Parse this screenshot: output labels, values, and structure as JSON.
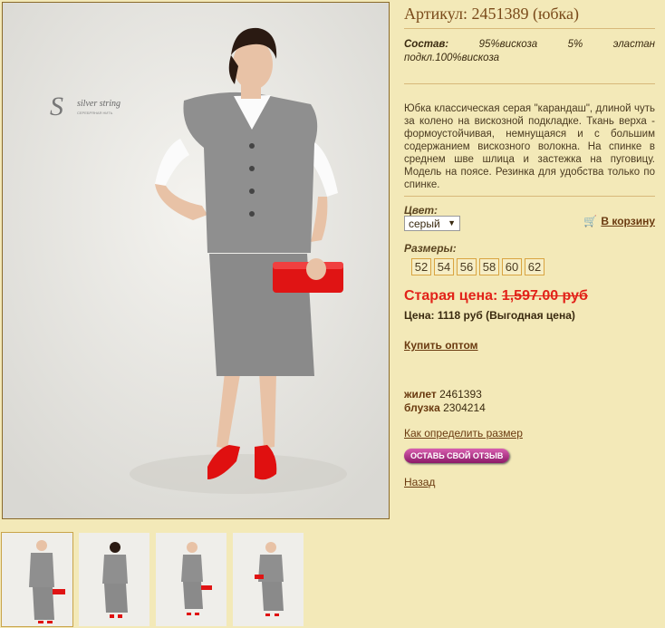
{
  "product": {
    "title": "Артикул: 2451389 (юбка)",
    "composition_label": "Состав:",
    "composition_text": "95%вискоза 5% эластан подкл.100%вискоза",
    "description": "Юбка классическая серая \"карандаш\", длиной чуть за колено на вискозной подкладке. Ткань верха - формоустойчивая, немнущаяся и с большим содержанием вискозного волокна. На спинке в среднем шве шлица и застежка на пуговицу. Модель на поясе. Резинка для удобства только по спинке.",
    "color_label": "Цвет:",
    "color_value": "серый",
    "cart_label": "В корзину",
    "sizes_label": "Размеры:",
    "sizes": [
      "52",
      "54",
      "56",
      "58",
      "60",
      "62"
    ],
    "old_price_label": "Старая цена:",
    "old_price_value": "1,597.00 руб",
    "price_text": "Цена: 1118 руб (Выгодная цена)",
    "wholesale_label": "Купить оптом",
    "related": [
      {
        "name": "жилет",
        "code": "2461393"
      },
      {
        "name": "блузка",
        "code": "2304214"
      }
    ],
    "size_help_label": "Как определить размер",
    "review_button_label": "ОСТАВЬ СВОЙ ОТЗЫВ",
    "back_label": "Назад"
  },
  "photo": {
    "brand_logo": "silver string",
    "brand_sub": "СЕРЕБРЯНАЯ НИТЬ"
  },
  "colors": {
    "background": "#f3e9b8",
    "accent": "#7a4a1a",
    "old_price": "#e2231a",
    "size_border": "#d9a441",
    "review_button": "#b0308a"
  }
}
